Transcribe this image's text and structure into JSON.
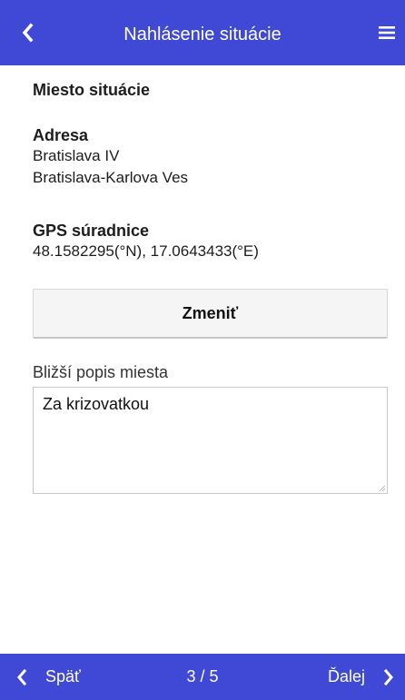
{
  "header": {
    "title": "Nahlásenie situácie",
    "back_icon": "chevron-left-icon",
    "menu_icon": "hamburger-menu-icon",
    "bar_color": "#3f49d6"
  },
  "main": {
    "section_title": "Miesto situácie",
    "address": {
      "label": "Adresa",
      "line1": "Bratislava IV",
      "line2": "Bratislava-Karlova Ves"
    },
    "gps": {
      "label": "GPS súradnice",
      "value": "48.1582295(°N), 17.0643433(°E)"
    },
    "change_button_label": "Zmeniť",
    "description": {
      "label": "Bližší popis miesta",
      "value": "Za krizovatkou"
    }
  },
  "footer": {
    "prev_label": "Späť",
    "page_indicator": "3 / 5",
    "next_label": "Ďalej",
    "prev_icon": "chevron-left-icon",
    "next_icon": "chevron-right-icon"
  }
}
